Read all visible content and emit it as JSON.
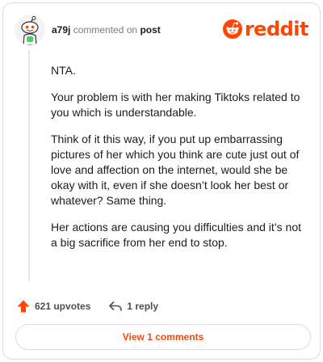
{
  "header": {
    "username": "a79j",
    "action_text": "commented on",
    "target_text": "post",
    "brand": "reddit"
  },
  "comment": {
    "paragraphs": [
      "NTA.",
      "Your problem is with her making Tiktoks related to you which is understandable.",
      "Think of it this way, if you put up embarrassing pictures of her which you think are cute just out of love and affection on the internet, would she be okay with it, even if she doesn’t look her best or whatever? Same thing.",
      "Her actions are causing you difficulties and it’s not a big sacrifice from her end to stop."
    ]
  },
  "actions": {
    "upvotes_label": "621 upvotes",
    "reply_label": "1 reply"
  },
  "footer": {
    "view_comments_label": "View 1 comments"
  },
  "icons": {
    "upvote": "upvote-arrow-icon",
    "reply": "reply-arrow-icon",
    "avatar": "snoo-avatar",
    "logo": "reddit-snoo-logo"
  },
  "colors": {
    "brand": "#ff4500",
    "text": "#1c1c1c",
    "muted": "#7c7c7c",
    "border": "#d9dce0"
  }
}
